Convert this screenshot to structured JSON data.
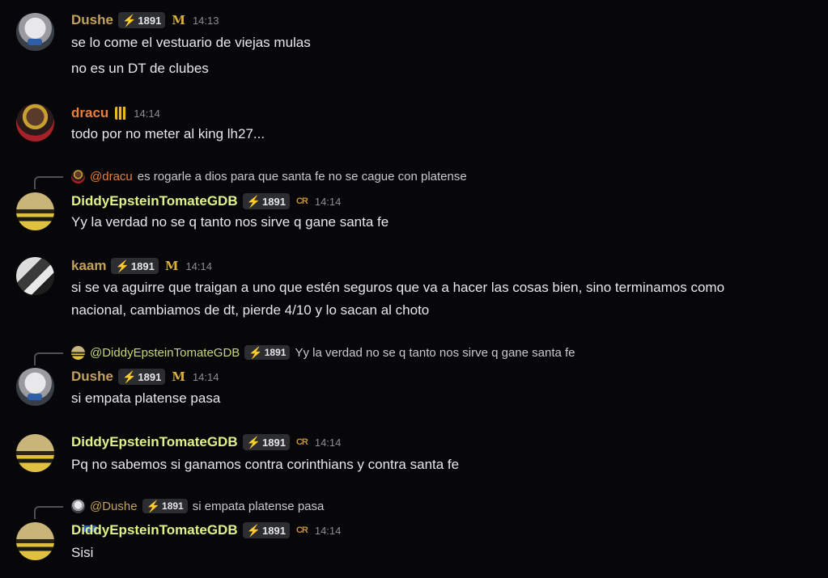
{
  "boost_badge": "1891",
  "messages": [
    {
      "author": "Dushe",
      "time": "14:13",
      "role_icon": "M-icon",
      "lines": [
        "se lo come el vestuario de viejas mulas",
        "no es un DT de clubes"
      ]
    },
    {
      "author": "dracu",
      "time": "14:14",
      "role_icon": "striped-shield-icon",
      "lines": [
        "todo por no meter al king lh27..."
      ]
    },
    {
      "reply": {
        "author": "@dracu",
        "text": "es rogarle a dios para que santa fe no se cague con platense"
      },
      "author": "DiddyEpsteinTomateGDB",
      "time": "14:14",
      "role_icon": "CR-icon",
      "lines": [
        "Yy la verdad no se q tanto nos sirve q gane santa fe"
      ]
    },
    {
      "author": "kaam",
      "time": "14:14",
      "role_icon": "M-icon",
      "lines": [
        "si se va aguirre que traigan a uno que estén seguros que va a hacer las cosas bien, sino terminamos como",
        "nacional, cambiamos de dt, pierde 4/10 y lo sacan al choto"
      ]
    },
    {
      "reply": {
        "author": "@DiddyEpsteinTomateGDB",
        "text": "Yy la verdad no se q tanto nos sirve q gane santa fe"
      },
      "author": "Dushe",
      "time": "14:14",
      "role_icon": "M-icon",
      "lines": [
        "si empata platense pasa"
      ]
    },
    {
      "author": "DiddyEpsteinTomateGDB",
      "time": "14:14",
      "role_icon": "CR-icon",
      "lines": [
        "Pq no sabemos si ganamos contra corinthians y contra santa fe"
      ]
    },
    {
      "reply": {
        "author": "@Dushe",
        "text": "si empata platense pasa"
      },
      "author": "DiddyEpsteinTomateGDB",
      "time": "14:14",
      "role_icon": "CR-icon",
      "lines": [
        "Sisi"
      ]
    }
  ],
  "role_glyphs": {
    "M": "M",
    "CR": "CR"
  },
  "bolt": "⚡"
}
